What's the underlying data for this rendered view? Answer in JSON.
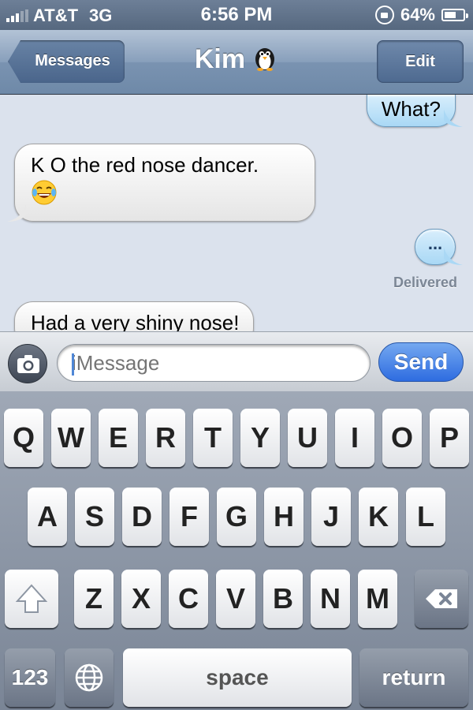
{
  "status_bar": {
    "carrier": "AT&T",
    "network": "3G",
    "time": "6:56 PM",
    "battery": "64%",
    "battery_level": 0.64
  },
  "nav": {
    "back_label": "Messages",
    "title": "Kim",
    "edit_label": "Edit"
  },
  "messages": [
    {
      "direction": "outgoing",
      "text": "What?"
    },
    {
      "direction": "incoming",
      "text": "K O the red nose dancer.",
      "emoji": "😂"
    },
    {
      "direction": "outgoing",
      "text": "..."
    },
    {
      "direction": "incoming",
      "text": "Had a very shiny nose!"
    }
  ],
  "delivered_label": "Delivered",
  "input": {
    "placeholder": "iMessage",
    "send_label": "Send"
  },
  "keyboard": {
    "row1": [
      "Q",
      "W",
      "E",
      "R",
      "T",
      "Y",
      "U",
      "I",
      "O",
      "P"
    ],
    "row2": [
      "A",
      "S",
      "D",
      "F",
      "G",
      "H",
      "J",
      "K",
      "L"
    ],
    "row3": [
      "Z",
      "X",
      "C",
      "V",
      "B",
      "N",
      "M"
    ],
    "numbers_label": "123",
    "space_label": "space",
    "return_label": "return"
  },
  "colors": {
    "accent": "#2e6ce0",
    "bubble_outgoing": "#a9d8f5",
    "bubble_incoming": "#ffffff",
    "conversation_bg": "#dbe2ed"
  },
  "icons": [
    "signal-icon",
    "lock-rotation-icon",
    "battery-icon",
    "penguin-icon",
    "camera-icon",
    "shift-icon",
    "backspace-icon",
    "globe-icon"
  ]
}
